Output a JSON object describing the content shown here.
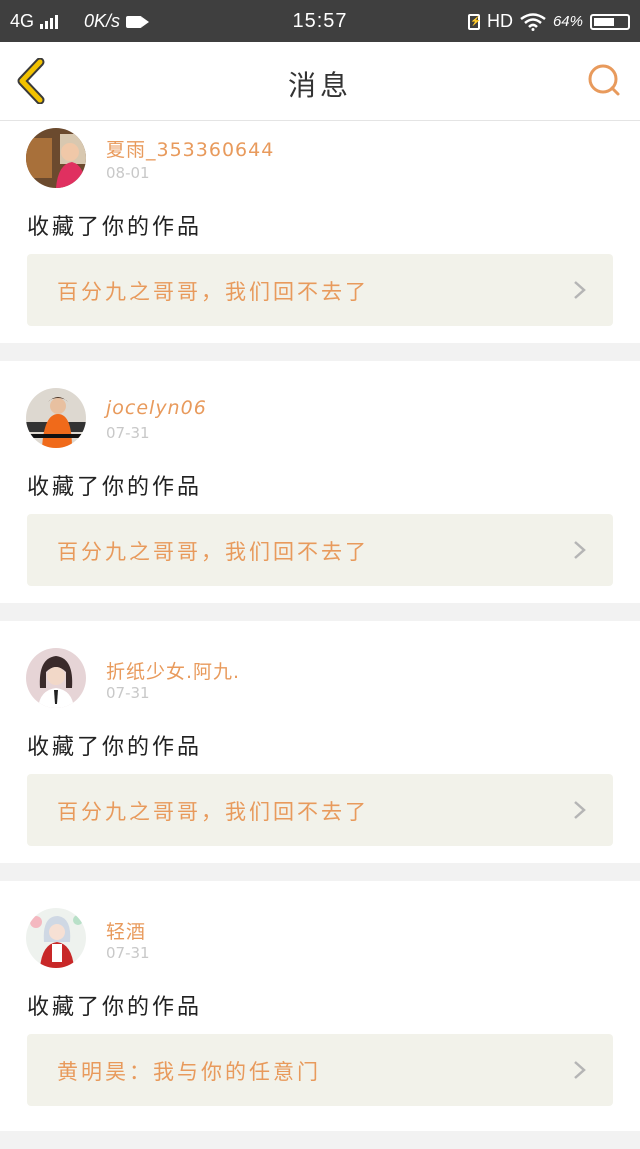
{
  "status_bar": {
    "network": "4G",
    "speed": "0K/s",
    "time": "15:57",
    "hd": "HD",
    "battery_percent": "64%",
    "battery_level": 0.64
  },
  "nav": {
    "title": "消息",
    "back_icon": "chevron-left-icon",
    "search_icon": "search-icon",
    "accent_color": "#e89a5c",
    "back_color": "#f2c200"
  },
  "messages": [
    {
      "username": "夏雨_353360644",
      "date": "08-01",
      "action": "收藏了你的作品",
      "work_title": "百分九之哥哥，我们回不去了"
    },
    {
      "username": "jocelyn06",
      "date": "07-31",
      "action": "收藏了你的作品",
      "work_title": "百分九之哥哥，我们回不去了"
    },
    {
      "username": "折纸少女.阿九.",
      "date": "07-31",
      "action": "收藏了你的作品",
      "work_title": "百分九之哥哥，我们回不去了"
    },
    {
      "username": "轻酒",
      "date": "07-31",
      "action": "收藏了你的作品",
      "work_title": "黄明昊：我与你的任意门"
    }
  ]
}
